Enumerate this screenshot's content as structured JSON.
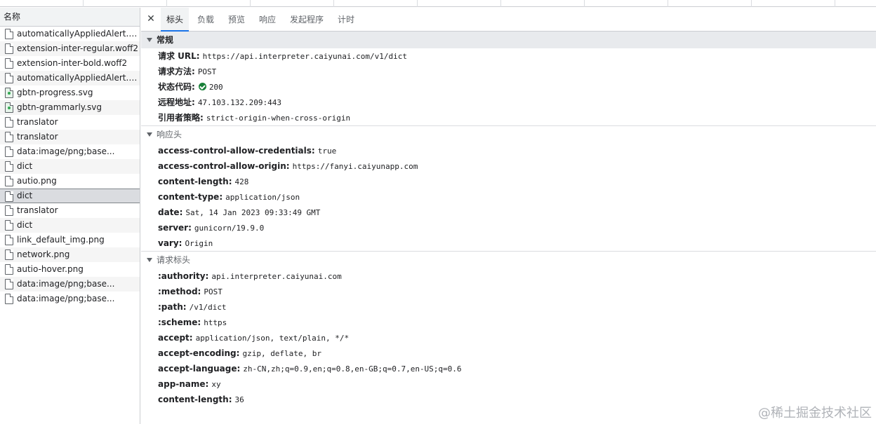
{
  "left_panel": {
    "header": "名称",
    "items": [
      {
        "name": "automaticallyAppliedAlert.styl...",
        "icon": "file-icon"
      },
      {
        "name": "extension-inter-regular.woff2",
        "icon": "file-icon"
      },
      {
        "name": "extension-inter-bold.woff2",
        "icon": "file-icon"
      },
      {
        "name": "automaticallyAppliedAlert.co...",
        "icon": "file-icon"
      },
      {
        "name": "gbtn-progress.svg",
        "icon": "image-file-icon"
      },
      {
        "name": "gbtn-grammarly.svg",
        "icon": "image-file-icon"
      },
      {
        "name": "translator",
        "icon": "file-icon"
      },
      {
        "name": "translator",
        "icon": "file-icon"
      },
      {
        "name": "data:image/png;base...",
        "icon": "file-icon"
      },
      {
        "name": "dict",
        "icon": "file-icon"
      },
      {
        "name": "autio.png",
        "icon": "file-icon"
      },
      {
        "name": "dict",
        "icon": "file-icon",
        "selected": true
      },
      {
        "name": "translator",
        "icon": "file-icon"
      },
      {
        "name": "dict",
        "icon": "file-icon"
      },
      {
        "name": "link_default_img.png",
        "icon": "file-icon"
      },
      {
        "name": "network.png",
        "icon": "file-icon"
      },
      {
        "name": "autio-hover.png",
        "icon": "file-icon"
      },
      {
        "name": "data:image/png;base...",
        "icon": "file-icon"
      },
      {
        "name": "data:image/png;base...",
        "icon": "file-icon"
      }
    ]
  },
  "tabs": {
    "close": "✕",
    "items": [
      "标头",
      "负载",
      "预览",
      "响应",
      "发起程序",
      "计时"
    ],
    "active": "标头"
  },
  "general": {
    "title": "常规",
    "rows": [
      {
        "key": "请求 URL:",
        "value": "https://api.interpreter.caiyunai.com/v1/dict"
      },
      {
        "key": "请求方法:",
        "value": "POST"
      },
      {
        "key": "状态代码:",
        "value": "200",
        "status_icon": "green-check-icon"
      },
      {
        "key": "远程地址:",
        "value": "47.103.132.209:443"
      },
      {
        "key": "引用者策略:",
        "value": "strict-origin-when-cross-origin"
      }
    ]
  },
  "response_headers": {
    "title": "响应头",
    "rows": [
      {
        "key": "access-control-allow-credentials:",
        "value": "true"
      },
      {
        "key": "access-control-allow-origin:",
        "value": "https://fanyi.caiyunapp.com"
      },
      {
        "key": "content-length:",
        "value": "428"
      },
      {
        "key": "content-type:",
        "value": "application/json"
      },
      {
        "key": "date:",
        "value": "Sat, 14 Jan 2023 09:33:49 GMT"
      },
      {
        "key": "server:",
        "value": "gunicorn/19.9.0"
      },
      {
        "key": "vary:",
        "value": "Origin"
      }
    ]
  },
  "request_headers": {
    "title": "请求标头",
    "rows": [
      {
        "key": ":authority:",
        "value": "api.interpreter.caiyunai.com"
      },
      {
        "key": ":method:",
        "value": "POST"
      },
      {
        "key": ":path:",
        "value": "/v1/dict"
      },
      {
        "key": ":scheme:",
        "value": "https"
      },
      {
        "key": "accept:",
        "value": "application/json, text/plain, */*"
      },
      {
        "key": "accept-encoding:",
        "value": "gzip, deflate, br"
      },
      {
        "key": "accept-language:",
        "value": "zh-CN,zh;q=0.9,en;q=0.8,en-GB;q=0.7,en-US;q=0.6"
      },
      {
        "key": "app-name:",
        "value": "xy"
      },
      {
        "key": "content-length:",
        "value": "36"
      }
    ]
  },
  "watermark": "@稀土掘金技术社区",
  "colors": {
    "accent": "#1a73e8",
    "status_ok": "#188038"
  }
}
